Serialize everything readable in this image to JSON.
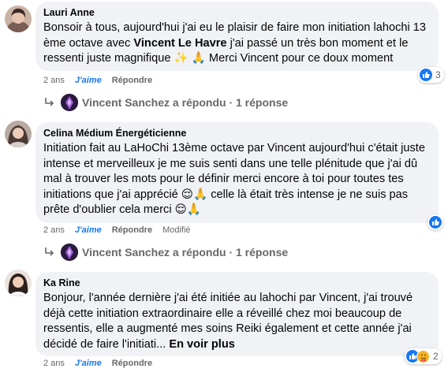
{
  "comments": [
    {
      "author": "Lauri Anne",
      "text_pre": "Bonsoir à tous, aujourd'hui j'ai eu le plaisir de faire mon initiation lahochi 13 ème octave avec ",
      "mention": "Vincent Le Havre",
      "text_post": " j'ai passé un très bon moment et le ressenti juste magnifique ✨ 🙏 Merci Vincent pour ce doux moment",
      "time": "2 ans",
      "like_label": "J'aime",
      "reply_label": "Répondre",
      "reaction_count": "3",
      "reply_summary": "Vincent Sanchez a répondu · 1 réponse"
    },
    {
      "author": "Celina Médium Énergéticienne",
      "text": "Initiation fait au LaHoChi 13ème octave par Vincent aujourd'hui c'était juste intense et merveilleux je me suis senti dans une telle plénitude que j'ai dû mal à trouver les mots pour le définir merci encore à toi pour toutes tes initiations que j'ai apprécié 😌🙏 celle là était très intense je ne suis pas prête d'oublier cela merci 😌🙏",
      "time": "2 ans",
      "like_label": "J'aime",
      "reply_label": "Répondre",
      "modified_label": "Modifié",
      "reply_summary": "Vincent Sanchez a répondu · 1 réponse"
    },
    {
      "author": "Ka Rine",
      "text": "Bonjour, l'année dernière j'ai été initiée au lahochi par Vincent, j'ai trouvé déjà cette initiation extraordinaire elle a réveillé chez moi beaucoup de ressentis, elle a augmenté mes soins Reiki également et cette année j'ai décidé de faire l'initiati... ",
      "see_more": "En voir plus",
      "time": "2 ans",
      "like_label": "J'aime",
      "reply_label": "Répondre",
      "reaction_count": "2"
    }
  ],
  "colors": {
    "bubble": "#f0f2f5",
    "link_blue": "#1877f2",
    "meta_grey": "#65676b"
  },
  "icons": {
    "like": "thumbs-up-icon",
    "care": "care-emoji-icon",
    "reply": "reply-arrow-icon"
  }
}
